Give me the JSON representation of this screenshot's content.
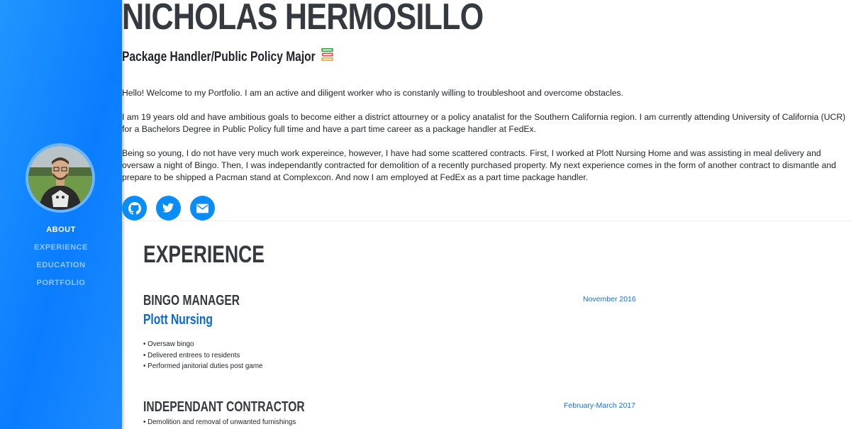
{
  "sidebar": {
    "nav": [
      {
        "label": "ABOUT",
        "active": true
      },
      {
        "label": "EXPERIENCE",
        "active": false
      },
      {
        "label": "EDUCATION",
        "active": false
      },
      {
        "label": "PORTFOLIO",
        "active": false
      }
    ]
  },
  "header": {
    "name": "NICHOLAS HERMOSILLO",
    "subtitle": "Package Handler/Public Policy Major"
  },
  "about": {
    "paragraphs": [
      "Hello! Welcome to my Portfolio. I am an active and diligent worker who is constanly willing to troubleshoot and overcome obstacles.",
      "I am 19 years old and have ambitious goals to become either a district attourney or a policy anatalist for the Southern California region. I am currently attending University of California (UCR) for a Bachelors Degree in Public Policy full time and have a part time career as a package handler at FedEx.",
      "Being so young, I do not have very much work expereince, however, I have had some scattered contracts. First, I worked at Plott Nursing Home and was assisting in meal delivery and oversaw a night of Bingo. Then, I was independantly contracted for demolition of a recently purchased property. My next experience comes in the form of another contract to dismantle and prepare to be shipped a Pacman stand at Complexcon. And now I am employed at FedEx as a part time package handler."
    ],
    "socials": [
      "github-icon",
      "twitter-icon",
      "envelope-icon"
    ]
  },
  "experience": {
    "title": "EXPERIENCE",
    "jobs": [
      {
        "title": "BINGO MANAGER",
        "company": "Plott Nursing",
        "date": "November 2016",
        "duties": [
          "Oversaw bingo",
          "Delivered entrees to residents",
          "Performed janitorial duties post game"
        ]
      },
      {
        "title": "INDEPENDANT CONTRACTOR",
        "company": "",
        "date": "February-March 2017",
        "duties": [
          "Demolition and removal of unwanted furnishings"
        ]
      }
    ]
  },
  "colors": {
    "sidebar": "#0a7dff",
    "accent": "#0a68d8",
    "social": "#0a8df7",
    "heading": "#343a40"
  }
}
